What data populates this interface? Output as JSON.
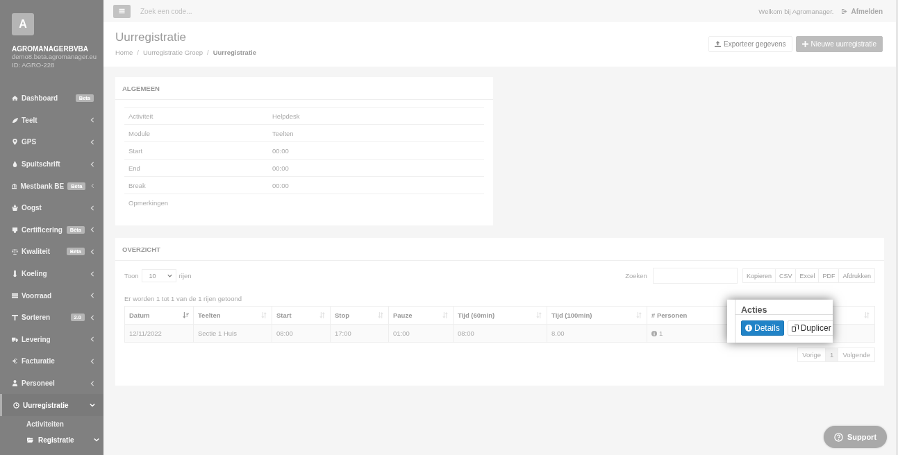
{
  "sidebar": {
    "avatar_letter": "A",
    "company": "AGROMANAGERBVBA",
    "domain": "demo8.beta.agromanager.eu",
    "account_id": "ID: AGRO-228",
    "items": [
      {
        "label": "Dashboard",
        "badge": "Beta",
        "selected": false
      },
      {
        "label": "Teelt",
        "expanded": false,
        "selected": false
      },
      {
        "label": "GPS",
        "expanded": false,
        "selected": false
      },
      {
        "label": "Spuitschrift",
        "expanded": false,
        "selected": false
      },
      {
        "label": "Mestbank BE",
        "badge": "Bèta",
        "expanded": false,
        "selected": false
      },
      {
        "label": "Oogst",
        "expanded": false,
        "selected": false
      },
      {
        "label": "Certificering",
        "badge": "Bèta",
        "expanded": false,
        "selected": false
      },
      {
        "label": "Kwaliteit",
        "badge": "Bèta",
        "expanded": false,
        "selected": false
      },
      {
        "label": "Koeling",
        "expanded": false,
        "selected": false
      },
      {
        "label": "Voorraad",
        "expanded": false,
        "selected": false
      },
      {
        "label": "Sorteren",
        "badge": "2.0",
        "expanded": false,
        "selected": false
      },
      {
        "label": "Levering",
        "expanded": false,
        "selected": false
      },
      {
        "label": "Facturatie",
        "expanded": false,
        "selected": false
      },
      {
        "label": "Personeel",
        "expanded": false,
        "selected": false
      },
      {
        "label": "Uurregistratie",
        "expanded": true,
        "selected": true,
        "children": [
          {
            "label": "Activiteiten",
            "selected": false
          },
          {
            "label": "Registratie",
            "expanded": true,
            "selected": true
          }
        ]
      }
    ]
  },
  "topbar": {
    "search": {
      "placeholder": "Zoek een code..."
    },
    "welcome": "Welkom bij Agromanager.",
    "logout": "Afmelden"
  },
  "header": {
    "title": "Uurregistratie",
    "breadcrumb_separators": [
      "/",
      "/"
    ],
    "breadcrumbs": [
      {
        "label": "Home",
        "current": false
      },
      {
        "label": "Uurregistratie Groep",
        "current": false
      },
      {
        "label": "Uurregistratie",
        "current": true
      }
    ],
    "buttons": [
      {
        "label": "Exporteer gegevens",
        "kind": "export"
      },
      {
        "label": "Nieuwe uurregistratie",
        "kind": "add"
      }
    ]
  },
  "general": {
    "title": "ALGEMEEN",
    "rows": [
      {
        "label": "Activiteit",
        "value": "Helpdesk"
      },
      {
        "label": "Module",
        "value": "Teelten"
      },
      {
        "label": "Start",
        "value": "00:00"
      },
      {
        "label": "End",
        "value": "00:00"
      },
      {
        "label": "Break",
        "value": "00:00"
      },
      {
        "label": "Opmerkingen"
      }
    ]
  },
  "overview": {
    "title": "OVERZICHT",
    "length": {
      "before": "Toon",
      "value": "10",
      "after": "rijen"
    },
    "search_label": "Zoeken",
    "export_buttons": [
      "Kopieren",
      "CSV",
      "Excel",
      "PDF",
      "Afdrukken"
    ],
    "info": "Er worden 1 tot 1 van de 1 rijen getoond",
    "table": {
      "columns": [
        {
          "label": "Datum",
          "sorted": true
        },
        {
          "label": "Teelten",
          "sorted": false
        },
        {
          "label": "Start",
          "sorted": false
        },
        {
          "label": "Stop",
          "sorted": false
        },
        {
          "label": "Pauze",
          "sorted": false
        },
        {
          "label": "Tijd (60min)",
          "sorted": false
        },
        {
          "label": "Tijd (100min)",
          "sorted": false
        },
        {
          "label": "# Personen"
        }
      ],
      "rows": [
        {
          "cells": [
            "12/11/2022",
            "Sectie 1 Huis",
            "08:00",
            "17:00",
            "01:00",
            "08:00",
            "8.00",
            "1"
          ]
        }
      ]
    },
    "pagination": [
      {
        "label": "Vorige",
        "selected": false
      },
      {
        "label": "1",
        "selected": true
      },
      {
        "label": "Volgende",
        "selected": false
      }
    ]
  },
  "actions_popup": {
    "title": "Acties",
    "buttons": [
      {
        "label": "Details",
        "kind": "primary"
      },
      {
        "label": "Duplicer",
        "kind": "copy"
      }
    ]
  },
  "support": "Support"
}
